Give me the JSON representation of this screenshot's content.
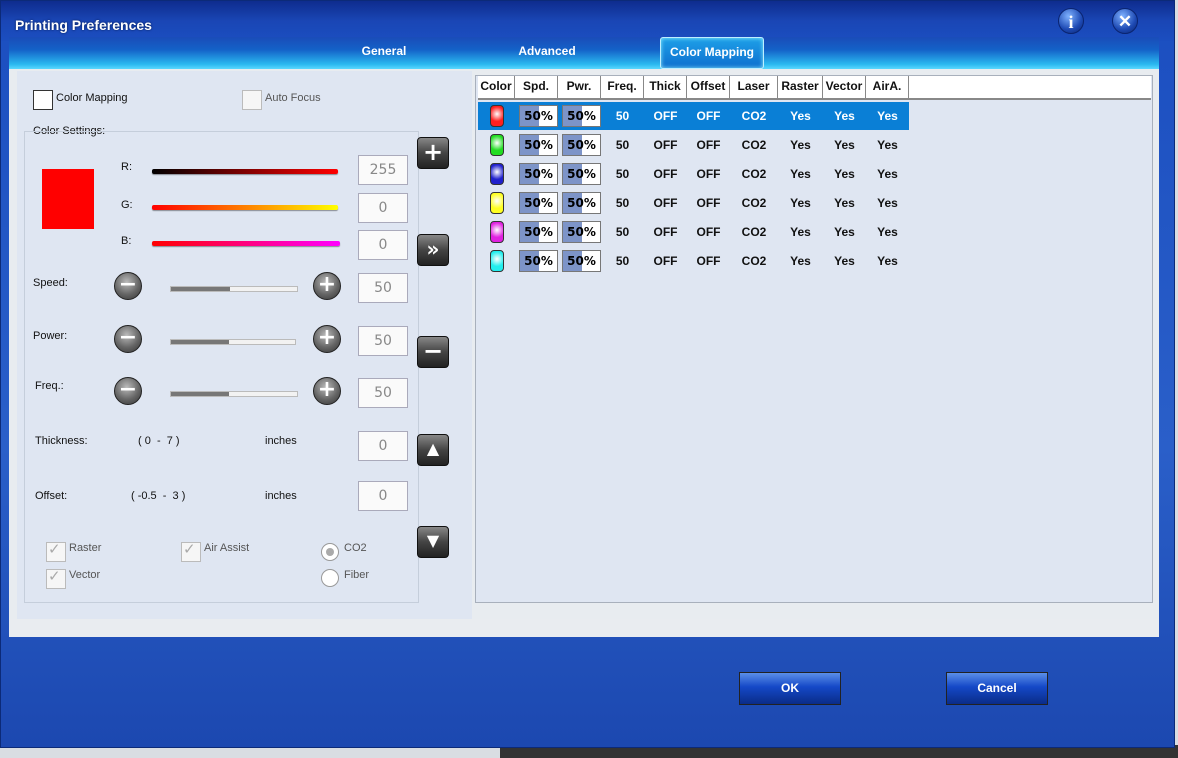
{
  "window": {
    "title": "Printing Preferences"
  },
  "tabs": [
    {
      "label": "General",
      "active": false
    },
    {
      "label": "Advanced",
      "active": false
    },
    {
      "label": "Color Mapping",
      "active": true
    }
  ],
  "left": {
    "color_mapping_label": "Color Mapping",
    "auto_focus_label": "Auto Focus",
    "color_settings_label": "Color Settings:",
    "current_color": "#ff0000",
    "rgb": [
      {
        "label": "R:",
        "value": "255"
      },
      {
        "label": "G:",
        "value": "0"
      },
      {
        "label": "B:",
        "value": "0"
      }
    ],
    "speed": {
      "label": "Speed:",
      "value": "50"
    },
    "power": {
      "label": "Power:",
      "value": "50"
    },
    "freq": {
      "label": "Freq.:",
      "value": "50"
    },
    "thickness": {
      "label": "Thickness:",
      "range": "( 0  -  7 )",
      "unit": "inches",
      "value": "0"
    },
    "offset": {
      "label": "Offset:",
      "range": "( -0.5  -  3 )",
      "unit": "inches",
      "value": "0"
    },
    "raster_label": "Raster",
    "vector_label": "Vector",
    "air_assist_label": "Air Assist",
    "co2_label": "CO2",
    "fiber_label": "Fiber"
  },
  "side_buttons": {
    "add": "+",
    "apply": "»",
    "remove": "−",
    "up": "▲",
    "down": "▼"
  },
  "table": {
    "headers": [
      "Color",
      "Spd.",
      "Pwr.",
      "Freq.",
      "Thick",
      "Offset",
      "Laser",
      "Raster",
      "Vector",
      "AirA."
    ],
    "rows": [
      {
        "color": "#ff1f1f",
        "spd": "50%",
        "pwr": "50%",
        "freq": "50",
        "thick": "OFF",
        "offset": "OFF",
        "laser": "CO2",
        "raster": "Yes",
        "vector": "Yes",
        "air": "Yes"
      },
      {
        "color": "#22dd22",
        "spd": "50%",
        "pwr": "50%",
        "freq": "50",
        "thick": "OFF",
        "offset": "OFF",
        "laser": "CO2",
        "raster": "Yes",
        "vector": "Yes",
        "air": "Yes"
      },
      {
        "color": "#2020cc",
        "spd": "50%",
        "pwr": "50%",
        "freq": "50",
        "thick": "OFF",
        "offset": "OFF",
        "laser": "CO2",
        "raster": "Yes",
        "vector": "Yes",
        "air": "Yes"
      },
      {
        "color": "#ffff22",
        "spd": "50%",
        "pwr": "50%",
        "freq": "50",
        "thick": "OFF",
        "offset": "OFF",
        "laser": "CO2",
        "raster": "Yes",
        "vector": "Yes",
        "air": "Yes"
      },
      {
        "color": "#e022e0",
        "spd": "50%",
        "pwr": "50%",
        "freq": "50",
        "thick": "OFF",
        "offset": "OFF",
        "laser": "CO2",
        "raster": "Yes",
        "vector": "Yes",
        "air": "Yes"
      },
      {
        "color": "#22eeee",
        "spd": "50%",
        "pwr": "50%",
        "freq": "50",
        "thick": "OFF",
        "offset": "OFF",
        "laser": "CO2",
        "raster": "Yes",
        "vector": "Yes",
        "air": "Yes"
      }
    ],
    "selected_row": 0,
    "bar_fraction": 0.5
  },
  "footer": {
    "ok_label": "OK",
    "cancel_label": "Cancel"
  }
}
